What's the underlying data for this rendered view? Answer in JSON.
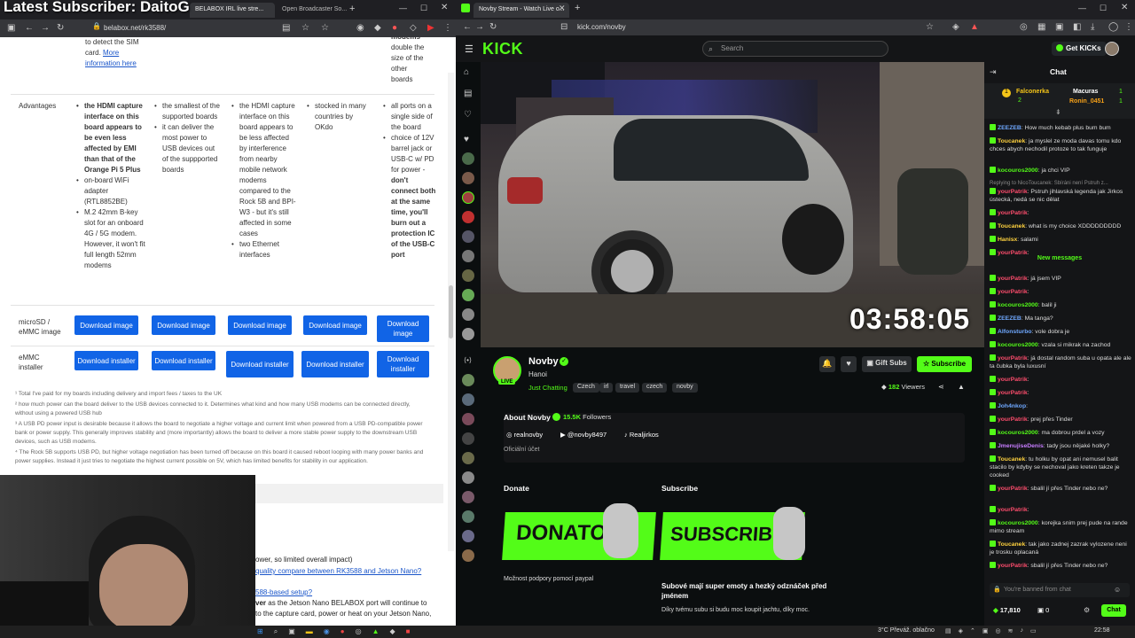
{
  "overlay": {
    "title": "Latest Subscriber: DaitoG"
  },
  "left_browser": {
    "tabs": [
      {
        "label": "BELABOX IRL live stre...",
        "active": true
      },
      {
        "label": "Open Broadcaster So...",
        "active": false
      }
    ],
    "new_tab": "+",
    "url": "belabox.net/rk3588/",
    "content": {
      "top_col1": {
        "line1": "to detect the SIM",
        "line2": "card. ",
        "link1": "More",
        "link2": "information here"
      },
      "top_col5": [
        "modems",
        "double the",
        "size of the",
        "other",
        "boards"
      ],
      "advantages_label": "Advantages",
      "adv_col1": {
        "bold": "the HDMI capture interface on this board appears to be even less affected by EMI than that of the Orange Pi 5 Plus",
        "items": [
          "on-board WiFi adapter (RTL8852BE)",
          "M.2 42mm B-key slot for an onboard 4G / 5G modem. However, it won't fit full length 52mm modems"
        ]
      },
      "adv_col2": {
        "items": [
          "the smallest of the supported boards",
          "it can deliver the most power to USB devices out of the suppported boards"
        ]
      },
      "adv_col3": {
        "items": [
          "the HDMI capture interface on this board appears to be less affected by interference from nearby mobile network modems compared to the Rock 5B and BPI-W3 - but it's still affected in some cases",
          "two Ethernet interfaces"
        ]
      },
      "adv_col4": {
        "items": [
          "stocked in many countries by OKdo"
        ]
      },
      "adv_col5": {
        "items": [
          "all ports on a single side of the board",
          "choice of 12V barrel jack or USB-C w/ PD for power - "
        ],
        "bold": "don't connect both at the same time, you'll burn out a protection IC of the USB-C port"
      },
      "microsd_label": "microSD / eMMC image",
      "download_image": "Download image",
      "emmc_label": "eMMC installer",
      "download_installer": "Download installer",
      "footnotes": [
        "¹ Total I've paid for my boards including delivery and import fees / taxes to the UK",
        "² how much power can the board deliver to the USB devices connected to it. Determines what kind and how many USB modems can be connected directly, without using a powered USB hub",
        "³ A USB PD power input is desirable because it allows the board to negotiate a higher voltage and current limit when powered from a USB PD-compatible power bank or power supply. This generally improves stability and (more importantly) allows the board to deliver a more stable power supply to the downstream USB devices, such as USB modems.",
        "⁴ The Rock 5B supports USB PD, but higher voltage negotiation has been turned off because on this board it caused reboot looping with many power banks and power supplies. Instead it just tries to negotiate the highest current possible on 5V, which has limited benefits for stability in our application."
      ],
      "bottom": {
        "line1": "ower, so limited overall impact)",
        "link2": "quality compare between RK3588 and Jetson Nano?",
        "link3": "588-based setup?",
        "line4_bold": "ver",
        "line4": " as the Jetson Nano BELABOX port will continue to",
        "line5": "to the capture card, power or heat on your Jetson Nano,"
      }
    }
  },
  "right_browser": {
    "tab": {
      "label": "Novby Stream - Watch Live o..."
    },
    "url": "kick.com/novby",
    "kick": {
      "logo": "KICK",
      "search_placeholder": "Search",
      "get_kicks": "Get KICKs",
      "timer": "03:58:05",
      "streamer": {
        "name": "Novby",
        "location": "Hanoi",
        "live_badge": "LIVE",
        "category": "Just Chatting",
        "tags": [
          "Czech",
          "irl",
          "travel",
          "czech",
          "novby"
        ],
        "viewers": "182",
        "viewers_label": "Viewers"
      },
      "gift_subs": "Gift Subs",
      "subscribe": "Subscribe",
      "about": {
        "title": "About Novby",
        "followers": "15.5K",
        "followers_label": "Followers",
        "socials": [
          "realnovby",
          "@novby8497",
          "Realjirkos"
        ],
        "official": "Oficiální účet"
      },
      "panels": {
        "donate_title": "Donate",
        "donate_banner": "DONATOSS",
        "donate_desc": "Možnost podpory pomocí paypal",
        "subscribe_title": "Subscribe",
        "subscribe_banner": "SUBSCRIBE",
        "subscribe_desc": "Subové mají super emoty a hezký odznáček před jménem",
        "subscribe_desc2": "Díky tvému subu si budu moc koupit jachtu, díky moc."
      },
      "chat": {
        "title": "Chat",
        "leaderboard": [
          {
            "rank": "1",
            "name": "Falconerka",
            "count": "2"
          },
          {
            "rank": "1",
            "name": "Macuras",
            "count": "1"
          },
          {
            "rank": "1",
            "name": "Ronin_0451",
            "count": "1"
          }
        ],
        "messages": [
          {
            "user": "ZEEZEB",
            "color": "#6fa8ff",
            "text": ": How much kebab plus bum bum"
          },
          {
            "user": "Toucanek",
            "color": "#ffd23f",
            "text": ": ja myslel ze moda davas tomu kdo chces abych nechodil protoze to tak funguje"
          },
          {
            "user": "kocouros2000",
            "color": "#53fc18",
            "text": ": ja chci VIP"
          },
          {
            "user": "yourPatrik",
            "color": "#ff4d6d",
            "text": ": Pstruh jihlavská legenda jak Jirkos ústecká, nedá se nic dělat",
            "reply": "Replying to NicoToucanek: Sbíráni není Pstruh z..."
          },
          {
            "user": "yourPatrik",
            "color": "#ff4d6d",
            "text": ":"
          },
          {
            "user": "Toucanek",
            "color": "#ffd23f",
            "text": ": what is my choice XDDDDDDDDD"
          },
          {
            "user": "Hanisx",
            "color": "#ffd23f",
            "text": ": salami"
          },
          {
            "user": "yourPatrik",
            "color": "#ff4d6d",
            "text": ":"
          },
          {
            "user": "yourPatrik",
            "color": "#ff4d6d",
            "text": ": já jsem VIP"
          },
          {
            "user": "yourPatrik",
            "color": "#ff4d6d",
            "text": ":"
          },
          {
            "user": "kocouros2000",
            "color": "#53fc18",
            "text": ": balil ji"
          },
          {
            "user": "ZEEZEB",
            "color": "#6fa8ff",
            "text": ": Ma tanga?"
          },
          {
            "user": "Alfonsturbo",
            "color": "#6fa8ff",
            "text": ": vole dobra je"
          },
          {
            "user": "kocouros2000",
            "color": "#53fc18",
            "text": ": vzala si mikrak na zachod"
          },
          {
            "user": "yourPatrik",
            "color": "#ff4d6d",
            "text": ": já dostal random suba u opata ale ale ta čubka byla luxusní"
          },
          {
            "user": "yourPatrik",
            "color": "#ff4d6d",
            "text": ":"
          },
          {
            "user": "yourPatrik",
            "color": "#ff4d6d",
            "text": ":"
          },
          {
            "user": "Joh4nkop",
            "color": "#6fa8ff",
            "text": ":"
          },
          {
            "user": "yourPatrik",
            "color": "#ff4d6d",
            "text": ": prej přes Tinder"
          },
          {
            "user": "kocouros2000",
            "color": "#53fc18",
            "text": ": ma dobrou prdel a vozy"
          },
          {
            "user": "JmenujiseDenis",
            "color": "#c77dff",
            "text": ": tady jsou nějaké holky?"
          },
          {
            "user": "Toucanek",
            "color": "#ffd23f",
            "text": ": tu holku by opat ani nemusel balit stacilo by kdyby se nechoval jako kreten takze je cooked"
          },
          {
            "user": "yourPatrik",
            "color": "#ff4d6d",
            "text": ": sbalil jí přes Tinder nebo ne?"
          },
          {
            "user": "yourPatrik",
            "color": "#ff4d6d",
            "text": ":"
          },
          {
            "user": "kocouros2000",
            "color": "#53fc18",
            "text": ": korejka snim prej pude na rande mimo stream"
          },
          {
            "user": "Toucanek",
            "color": "#ffd23f",
            "text": ": tak jako zadnej zazrak vylozene neni je trosku oplacaná"
          },
          {
            "user": "yourPatrik",
            "color": "#ff4d6d",
            "text": ": sbalil jí přes Tinder nebo ne?"
          }
        ],
        "new_messages": "New messages",
        "banned": "You're banned from chat",
        "points": "17,810",
        "zero": "0",
        "chat_button": "Chat"
      }
    }
  },
  "taskbar": {
    "weather": "3°C  Převáž. oblačno",
    "time": "22:58"
  },
  "colors": {
    "kick_green": "#53fc18",
    "download_blue": "#1164e6"
  }
}
